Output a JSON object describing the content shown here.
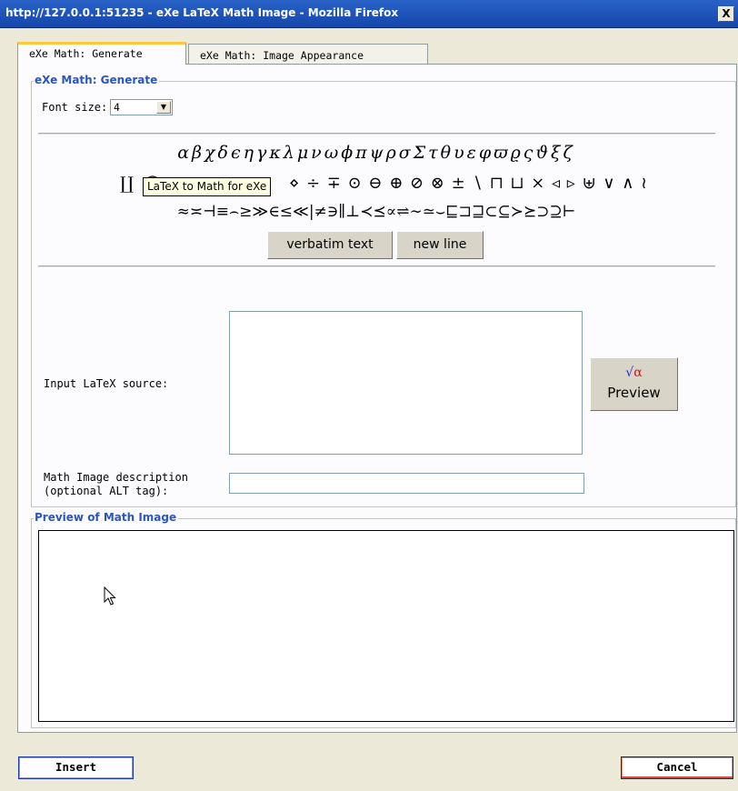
{
  "window": {
    "title": "http://127.0.0.1:51235 - eXe LaTeX Math Image - Mozilla Firefox",
    "close_glyph": "X"
  },
  "tabs": [
    {
      "label": "eXe Math: Generate",
      "active": true
    },
    {
      "label": "eXe Math: Image Appearance",
      "active": false
    }
  ],
  "generate": {
    "legend": "eXe Math: Generate",
    "font_size_label": "Font size:",
    "font_size_value": "4"
  },
  "symbols": {
    "row1": "αβχδϵηγκλμνωϕπψρσΣτθυεφϖϱςϑξζ",
    "row2_start": "∐ ◯",
    "row2_end": "⋄ ÷ ∓ ⊙ ⊖ ⊕ ⊘ ⊗ ± ∖ ⊓ ⊔ × ◃ ▹ ⊎ ∨ ∧ ≀",
    "row3": "≈≍⊣≡⌢≥≫∈≤≪|≠∋∥⊥≺⪯∝⇌∼≃⌣⊑⊐⊒⊂⊆≻⪰⊃⊇⊢",
    "tooltip": "LaTeX to Math for eXe"
  },
  "buttons": {
    "verbatim": "verbatim text",
    "new_line": "new line",
    "preview": "Preview",
    "insert": "Insert",
    "cancel": "Cancel"
  },
  "inputs": {
    "latex_label": "Input LaTeX source:",
    "latex_value": "",
    "description_label_1": "Math Image description",
    "description_label_2": "(optional ALT tag):",
    "description_value": ""
  },
  "preview_section": {
    "legend": "Preview of Math Image"
  },
  "icons": {
    "preview_icon": "sqrt-alpha-icon",
    "cursor": "mouse-pointer-icon"
  }
}
